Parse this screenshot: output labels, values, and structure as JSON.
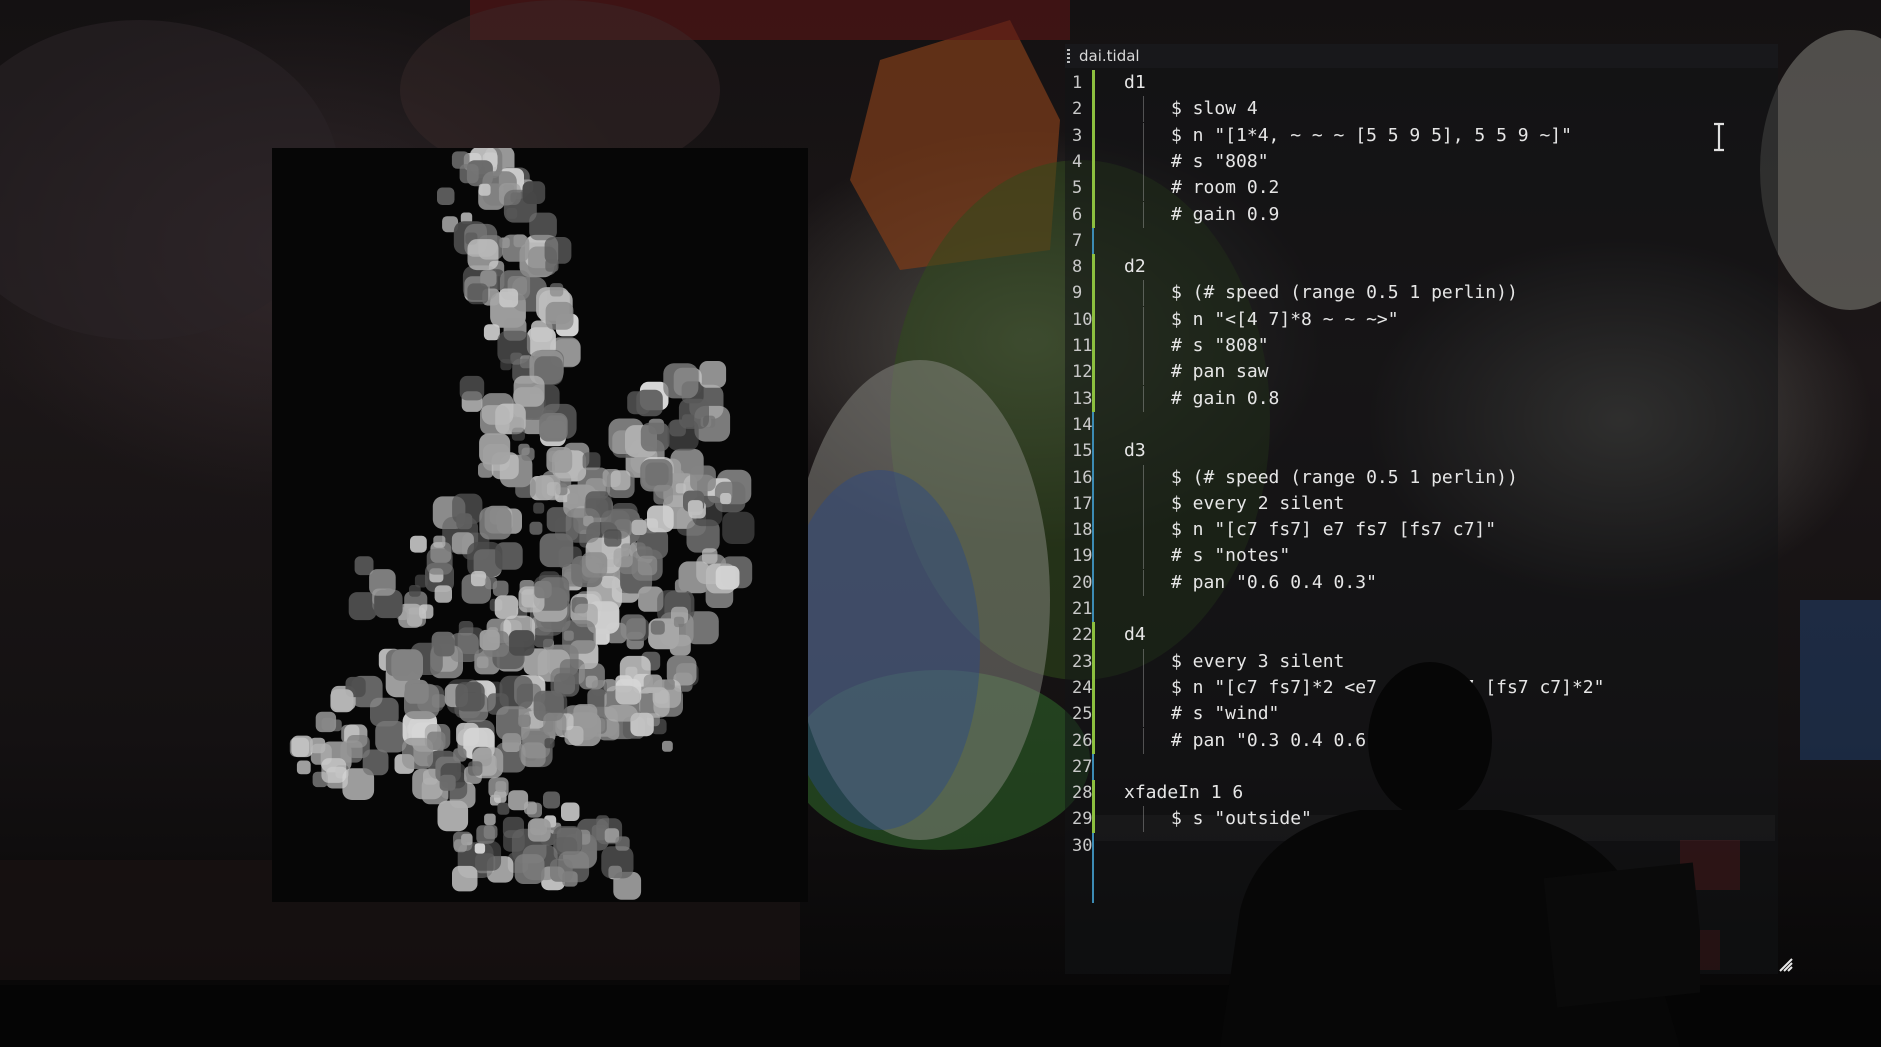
{
  "editor": {
    "tab_title": "dai.tidal",
    "lines": [
      {
        "n": "1",
        "text": "d1",
        "indent": false
      },
      {
        "n": "2",
        "text": "$ slow 4",
        "indent": true
      },
      {
        "n": "3",
        "text": "$ n \"[1*4, ~ ~ ~ [5 5 9 5], 5 5 9 ~]\"",
        "indent": true
      },
      {
        "n": "4",
        "text": "# s \"808\"",
        "indent": true
      },
      {
        "n": "5",
        "text": "# room 0.2",
        "indent": true
      },
      {
        "n": "6",
        "text": "# gain 0.9",
        "indent": true
      },
      {
        "n": "7",
        "text": "",
        "indent": false
      },
      {
        "n": "8",
        "text": "d2",
        "indent": false
      },
      {
        "n": "9",
        "text": "$ (# speed (range 0.5 1 perlin))",
        "indent": true
      },
      {
        "n": "10",
        "text": "$ n \"<[4 7]*8 ~ ~ ~>\"",
        "indent": true
      },
      {
        "n": "11",
        "text": "# s \"808\"",
        "indent": true
      },
      {
        "n": "12",
        "text": "# pan saw",
        "indent": true
      },
      {
        "n": "13",
        "text": "# gain 0.8",
        "indent": true
      },
      {
        "n": "14",
        "text": "",
        "indent": false
      },
      {
        "n": "15",
        "text": "d3",
        "indent": false
      },
      {
        "n": "16",
        "text": "$ (# speed (range 0.5 1 perlin))",
        "indent": true
      },
      {
        "n": "17",
        "text": "$ every 2 silent",
        "indent": true
      },
      {
        "n": "18",
        "text": "$ n \"[c7 fs7] e7 fs7 [fs7 c7]\"",
        "indent": true
      },
      {
        "n": "19",
        "text": "# s \"notes\"",
        "indent": true
      },
      {
        "n": "20",
        "text": "# pan \"0.6 0.4 0.3\"",
        "indent": true
      },
      {
        "n": "21",
        "text": "",
        "indent": false
      },
      {
        "n": "22",
        "text": "d4",
        "indent": false
      },
      {
        "n": "23",
        "text": "$ every 3 silent",
        "indent": true
      },
      {
        "n": "24",
        "text": "$ n \"[c7 fs7]*2 <e7 fs7> fs7 [fs7 c7]*2\"",
        "indent": true
      },
      {
        "n": "25",
        "text": "# s \"wind\"",
        "indent": true
      },
      {
        "n": "26",
        "text": "# pan \"0.3 0.4 0.6\"",
        "indent": true
      },
      {
        "n": "27",
        "text": "",
        "indent": false
      },
      {
        "n": "28",
        "text": "xfadeIn 1 6",
        "indent": false
      },
      {
        "n": "29",
        "text": "$ s \"outside\"",
        "indent": true
      },
      {
        "n": "30",
        "text": "",
        "indent": false
      }
    ]
  },
  "colors": {
    "gutter_modified": "#8cbf3f",
    "gutter_border": "#3c8bb4",
    "code_text": "#e6e6e6"
  },
  "icons": [
    "text-cursor-icon",
    "resize-handle-icon"
  ]
}
